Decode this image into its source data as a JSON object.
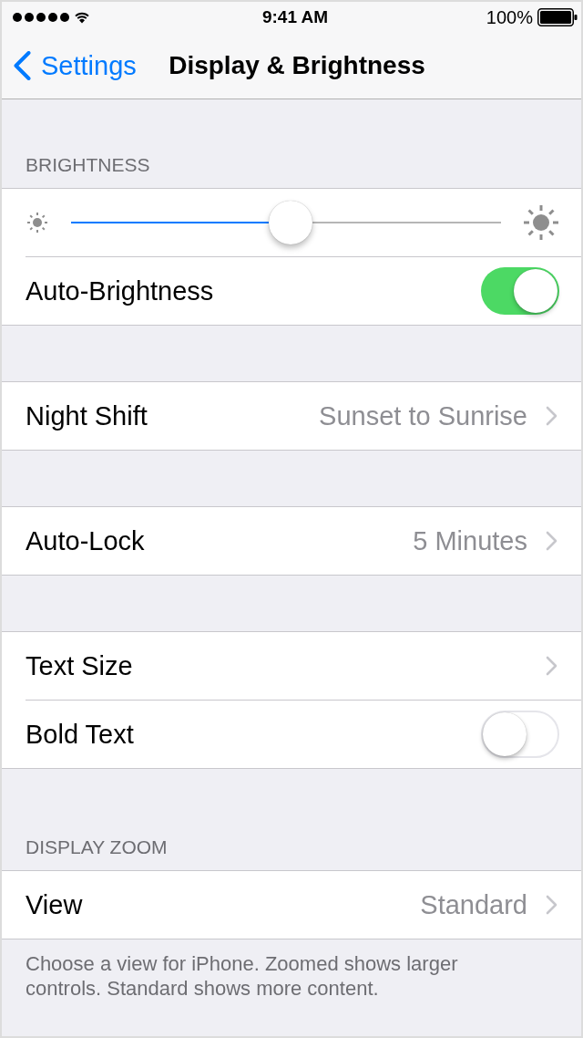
{
  "status_bar": {
    "time": "9:41 AM",
    "battery": "100%"
  },
  "nav": {
    "back": "Settings",
    "title": "Display & Brightness"
  },
  "sections": [
    {
      "header": "BRIGHTNESS",
      "rows": [
        {
          "kind": "slider",
          "level": 0.51
        },
        {
          "kind": "toggle",
          "label": "Auto-Brightness",
          "on": true
        }
      ]
    },
    {
      "rows": [
        {
          "kind": "link",
          "label": "Night Shift",
          "value": "Sunset to Sunrise"
        }
      ]
    },
    {
      "rows": [
        {
          "kind": "link",
          "label": "Auto-Lock",
          "value": "5 Minutes"
        }
      ]
    },
    {
      "rows": [
        {
          "kind": "link",
          "label": "Text Size"
        },
        {
          "kind": "toggle",
          "label": "Bold Text",
          "on": false
        }
      ]
    },
    {
      "header": "DISPLAY ZOOM",
      "rows": [
        {
          "kind": "link",
          "label": "View",
          "value": "Standard"
        }
      ],
      "footer": "Choose a view for iPhone. Zoomed shows larger controls. Standard shows more content."
    }
  ]
}
